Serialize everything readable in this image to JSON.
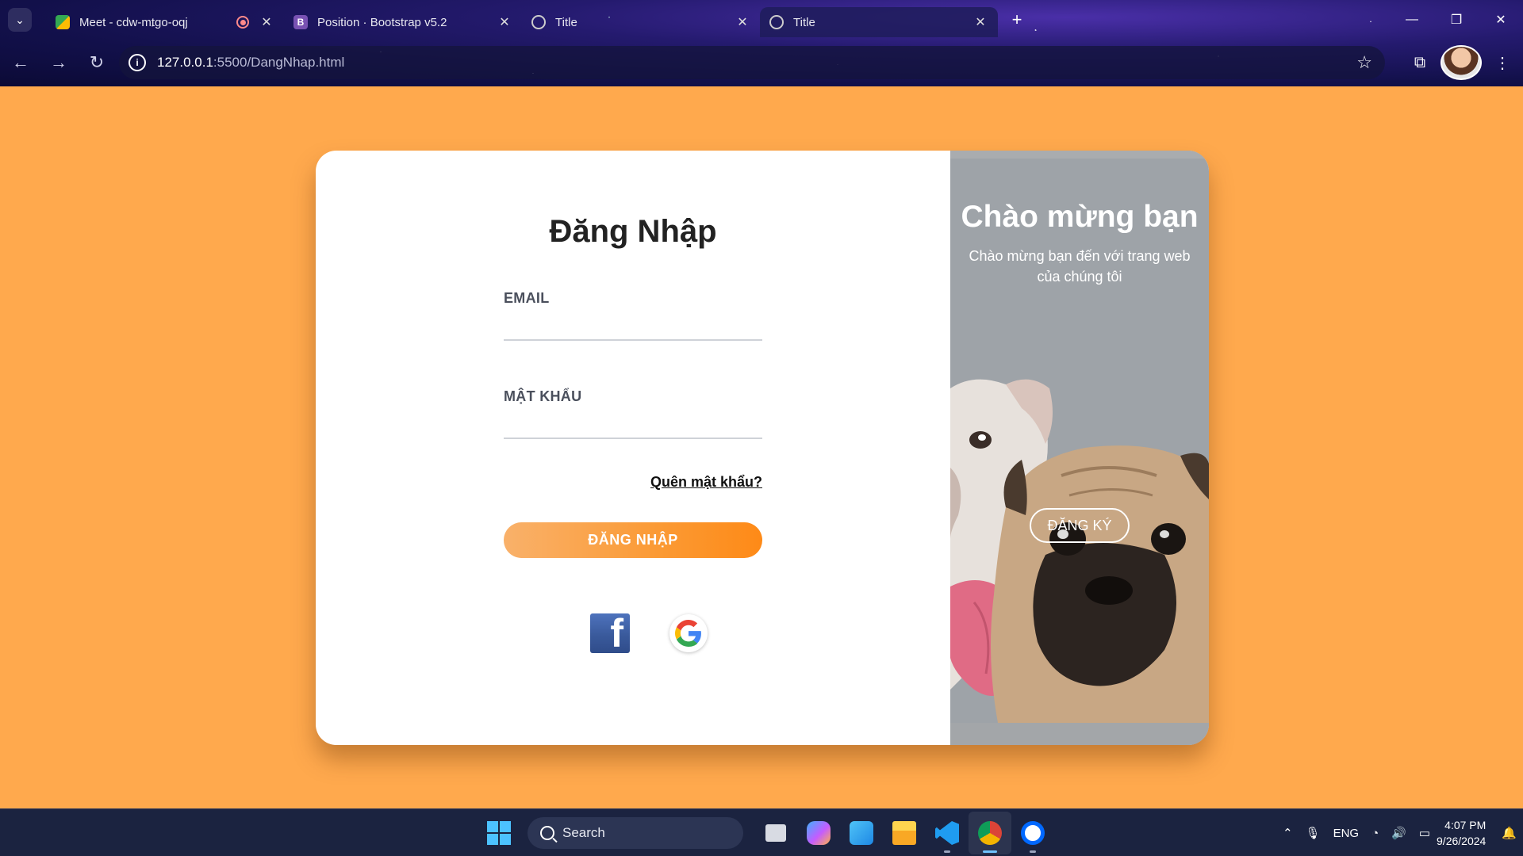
{
  "browser": {
    "tabs": [
      {
        "title": "Meet - cdw-mtgo-oqj",
        "active": false,
        "recording": true
      },
      {
        "title": "Position · Bootstrap v5.2",
        "active": false,
        "recording": false
      },
      {
        "title": "Title",
        "active": false,
        "recording": false
      },
      {
        "title": "Title",
        "active": true,
        "recording": false
      }
    ],
    "new_tab": "+",
    "url_host": "127.0.0.1",
    "url_path": ":5500/DangNhap.html"
  },
  "login": {
    "title": "Đăng Nhập",
    "email_label": "EMAIL",
    "email_value": "",
    "password_label": "MẬT KHẨU",
    "password_value": "",
    "forgot": "Quên mật khẩu?",
    "submit": "ĐĂNG NHẬP",
    "facebook_letter": "f"
  },
  "welcome": {
    "title": "Chào mừng bạn",
    "subtitle": "Chào mừng bạn đến với trang web của chúng tôi",
    "signup": "ĐĂNG KÝ"
  },
  "taskbar": {
    "search_placeholder": "Search",
    "language": "ENG",
    "time": "4:07 PM",
    "date": "9/26/2024"
  },
  "colors": {
    "page_bg": "#ffa94d",
    "accent": "#fb9a34",
    "panel": "#9ea3a8"
  }
}
